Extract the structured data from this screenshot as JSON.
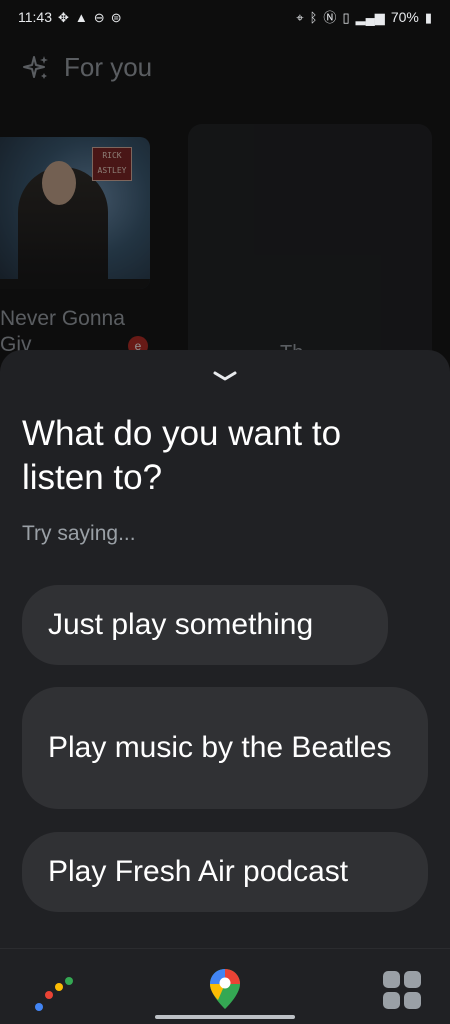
{
  "status_bar": {
    "time": "11:43",
    "battery": "70%",
    "left_icons": [
      "slack-icon",
      "navigation-icon",
      "minus-circle-icon",
      "steering-icon"
    ],
    "right_icons": [
      "location-icon",
      "bluetooth-icon",
      "nfc-icon",
      "vibrate-icon",
      "4g-signal-icon",
      "battery-icon"
    ]
  },
  "background": {
    "section_title": "For you",
    "card1": {
      "album_badge": "RICK ASTLEY",
      "track_title": "Never Gonna Giv"
    },
    "card2": {
      "partial_text": "Th"
    }
  },
  "sheet": {
    "heading": "What do you want to listen to?",
    "subheading": "Try saying...",
    "suggestions": [
      "Just play something",
      "Play music by the Beatles",
      "Play Fresh Air podcast"
    ]
  },
  "nav": {
    "left_icon": "google-assistant-dots-icon",
    "center_icon": "google-maps-icon",
    "right_icon": "app-grid-icon"
  },
  "colors": {
    "sheet_bg": "#202124",
    "chip_bg": "#303134",
    "text_primary": "#ffffff",
    "text_secondary": "#9aa0a6"
  }
}
